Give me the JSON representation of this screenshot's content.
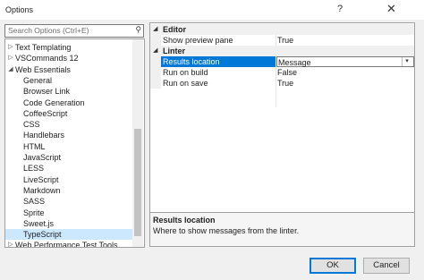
{
  "window": {
    "title": "Options",
    "help_glyph": "?",
    "close_glyph": "✕"
  },
  "search": {
    "placeholder": "Search Options (Ctrl+E)"
  },
  "tree": {
    "items": [
      {
        "label": "Text Templating",
        "expander": "▷",
        "selected": false
      },
      {
        "label": "VSCommands 12",
        "expander": "▷",
        "selected": false
      },
      {
        "label": "Web Essentials",
        "expander": "◢",
        "selected": false
      },
      {
        "label": "General",
        "expander": "",
        "selected": false
      },
      {
        "label": "Browser Link",
        "expander": "",
        "selected": false
      },
      {
        "label": "Code Generation",
        "expander": "",
        "selected": false
      },
      {
        "label": "CoffeeScript",
        "expander": "",
        "selected": false
      },
      {
        "label": "CSS",
        "expander": "",
        "selected": false
      },
      {
        "label": "Handlebars",
        "expander": "",
        "selected": false
      },
      {
        "label": "HTML",
        "expander": "",
        "selected": false
      },
      {
        "label": "JavaScript",
        "expander": "",
        "selected": false
      },
      {
        "label": "LESS",
        "expander": "",
        "selected": false
      },
      {
        "label": "LiveScript",
        "expander": "",
        "selected": false
      },
      {
        "label": "Markdown",
        "expander": "",
        "selected": false
      },
      {
        "label": "SASS",
        "expander": "",
        "selected": false
      },
      {
        "label": "Sprite",
        "expander": "",
        "selected": false
      },
      {
        "label": "Sweet.js",
        "expander": "",
        "selected": false
      },
      {
        "label": "TypeScript",
        "expander": "",
        "selected": true
      },
      {
        "label": "Web Performance Test Tools",
        "expander": "▷",
        "selected": false
      }
    ]
  },
  "grid": {
    "categories": [
      {
        "name": "Editor",
        "expander": "◢",
        "properties": [
          {
            "name": "Show preview pane",
            "value": "True",
            "selected": false
          }
        ]
      },
      {
        "name": "Linter",
        "expander": "◢",
        "properties": [
          {
            "name": "Results location",
            "value": "Message",
            "selected": true
          },
          {
            "name": "Run on build",
            "value": "False",
            "selected": false
          },
          {
            "name": "Run on save",
            "value": "True",
            "selected": false
          }
        ]
      }
    ],
    "dropdown_glyph": "▾"
  },
  "description": {
    "title": "Results location",
    "text": "Where to show messages from the linter."
  },
  "buttons": {
    "ok": "OK",
    "cancel": "Cancel"
  },
  "colors": {
    "selection": "#0078d7",
    "tree_selection": "#cce8ff"
  }
}
